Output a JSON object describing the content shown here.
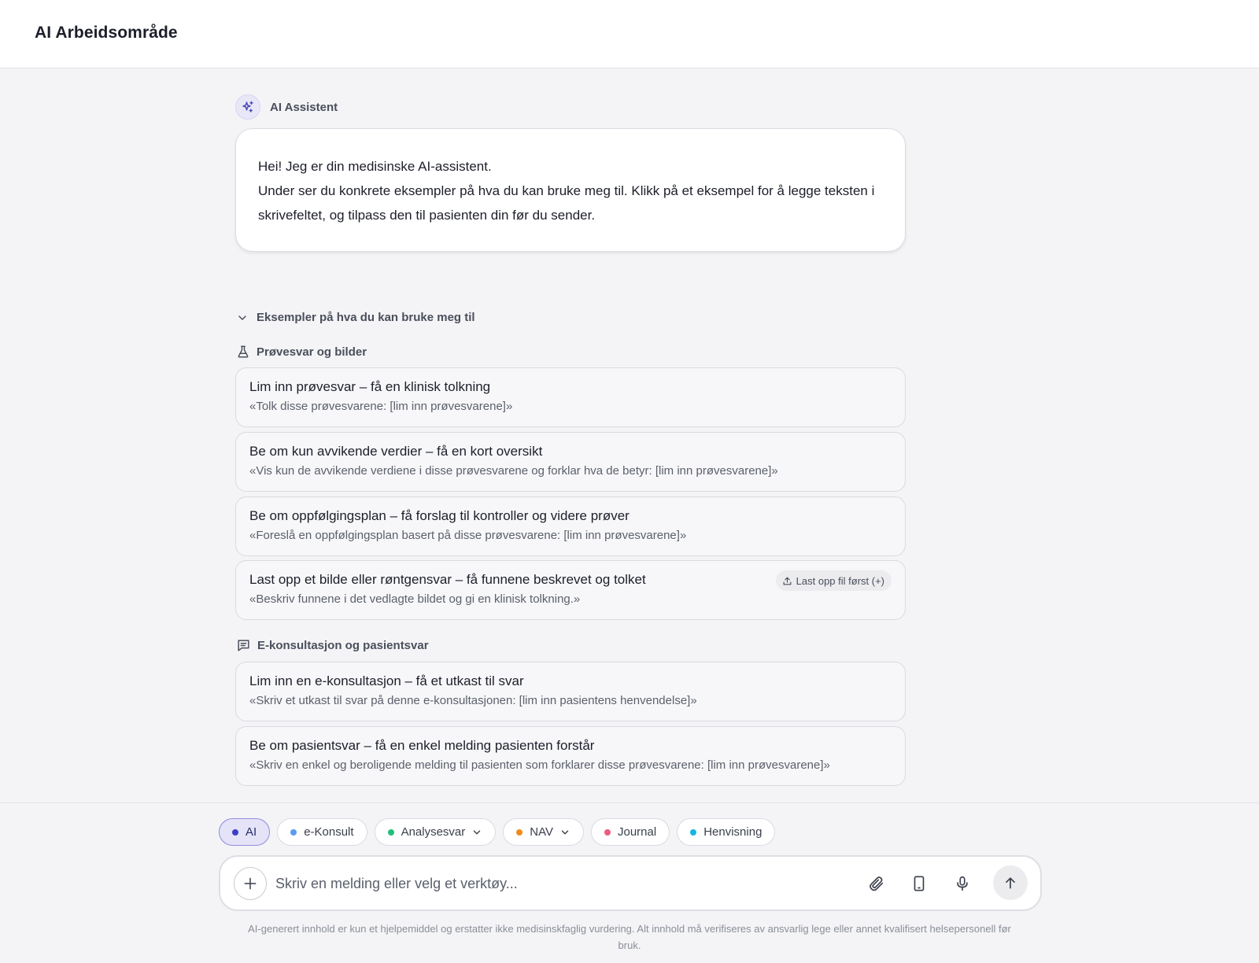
{
  "app": {
    "title": "AI Arbeidsområde"
  },
  "assistant": {
    "name": "AI Assistent",
    "greeting": "Hei! Jeg er din medisinske AI-assistent.",
    "intro": "Under ser du konkrete eksempler på hva du kan bruke meg til. Klikk på et eksempel for å legge teksten i skrivefeltet, og tilpass den til pasienten din før du sender."
  },
  "examples": {
    "toggle_label": "Eksempler på hva du kan bruke meg til",
    "sections": [
      {
        "title": "Prøvesvar og bilder",
        "icon": "flask-icon",
        "cards": [
          {
            "title": "Lim inn prøvesvar – få en klinisk tolkning",
            "prompt": "«Tolk disse prøvesvarene: [lim inn prøvesvarene]»"
          },
          {
            "title": "Be om kun avvikende verdier – få en kort oversikt",
            "prompt": "«Vis kun de avvikende verdiene i disse prøvesvarene og forklar hva de betyr: [lim inn prøvesvarene]»"
          },
          {
            "title": "Be om oppfølgingsplan – få forslag til kontroller og videre prøver",
            "prompt": "«Foreslå en oppfølgingsplan basert på disse prøvesvarene: [lim inn prøvesvarene]»"
          },
          {
            "title": "Last opp et bilde eller røntgensvar – få funnene beskrevet og tolket",
            "prompt": "«Beskriv funnene i det vedlagte bildet og gi en klinisk tolkning.»",
            "badge": "Last opp fil først (+)"
          }
        ]
      },
      {
        "title": "E-konsultasjon og pasientsvar",
        "icon": "message-icon",
        "cards": [
          {
            "title": "Lim inn en e-konsultasjon – få et utkast til svar",
            "prompt": "«Skriv et utkast til svar på denne e-konsultasjonen: [lim inn pasientens henvendelse]»"
          },
          {
            "title": "Be om pasientsvar – få en enkel melding pasienten forstår",
            "prompt": "«Skriv en enkel og beroligende melding til pasienten som forklarer disse prøvesvarene: [lim inn prøvesvarene]»"
          }
        ]
      }
    ]
  },
  "modes": [
    {
      "label": "AI",
      "color": "#3b3fc4",
      "active": true
    },
    {
      "label": "e-Konsult",
      "color": "#5b9bf0"
    },
    {
      "label": "Analysesvar",
      "color": "#1fbf7a",
      "dropdown": true
    },
    {
      "label": "NAV",
      "color": "#f28c1a",
      "dropdown": true
    },
    {
      "label": "Journal",
      "color": "#ef5b7f"
    },
    {
      "label": "Henvisning",
      "color": "#17b5e3"
    }
  ],
  "composer": {
    "placeholder": "Skriv en melding eller velg et verktøy...",
    "value": ""
  },
  "disclaimer": "AI-generert innhold er kun et hjelpemiddel og erstatter ikke medisinskfaglig vurdering. Alt innhold må verifiseres av ansvarlig lege eller annet kvalifisert helsepersonell før bruk."
}
